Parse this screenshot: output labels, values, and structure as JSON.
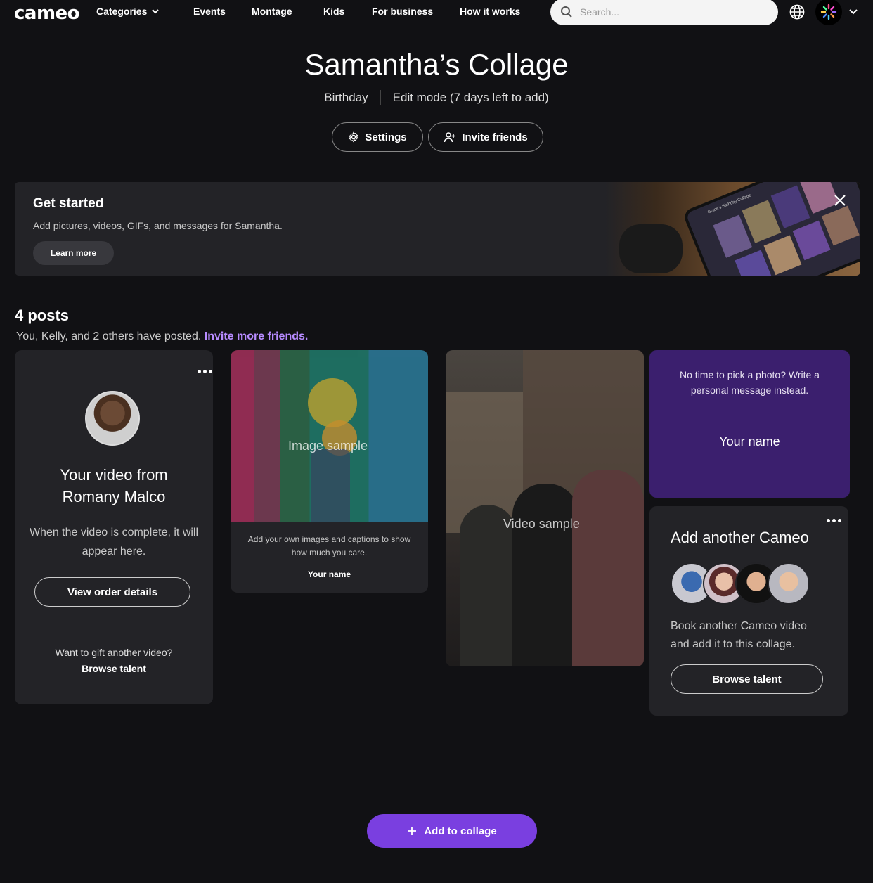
{
  "nav": {
    "logo": "cameo",
    "links": [
      "Categories",
      "Events",
      "Montage",
      "Kids",
      "For business",
      "How it works"
    ],
    "search_placeholder": "Search..."
  },
  "header": {
    "title": "Samantha’s Collage",
    "occasion": "Birthday",
    "mode": "Edit mode (7 days left to add)",
    "settings_label": "Settings",
    "invite_label": "Invite friends"
  },
  "banner": {
    "title": "Get started",
    "text": "Add pictures, videos, GIFs, and messages for Samantha.",
    "button": "Learn more",
    "image_caption": "Grace's Birthday Collage"
  },
  "posts": {
    "count_label": "4 posts",
    "summary": "You, Kelly, and 2 others have posted.",
    "invite_link": "Invite more friends."
  },
  "cards": {
    "video_card": {
      "title_line1": "Your video from",
      "title_line2": "Romany Malco",
      "description": "When the video is complete, it will appear here.",
      "button": "View order details",
      "gift_text": "Want to gift another video?",
      "browse_link": "Browse talent"
    },
    "image_card": {
      "overlay": "Image sample",
      "caption": "Add your own images and captions to show how much you care.",
      "name": "Your name"
    },
    "video_sample_card": {
      "overlay": "Video sample"
    },
    "message_card": {
      "message": "No time to pick a photo? Write a personal message instead.",
      "name": "Your name"
    },
    "add_cameo_card": {
      "title": "Add another Cameo",
      "description": "Book another Cameo video and add it to this collage.",
      "button": "Browse talent"
    }
  },
  "footer": {
    "add_button": "Add to collage"
  },
  "colors": {
    "background": "#111114",
    "card": "#232327",
    "accent": "#7a3fe0",
    "link": "#b78bff",
    "message_card": "#3b1f6e"
  }
}
